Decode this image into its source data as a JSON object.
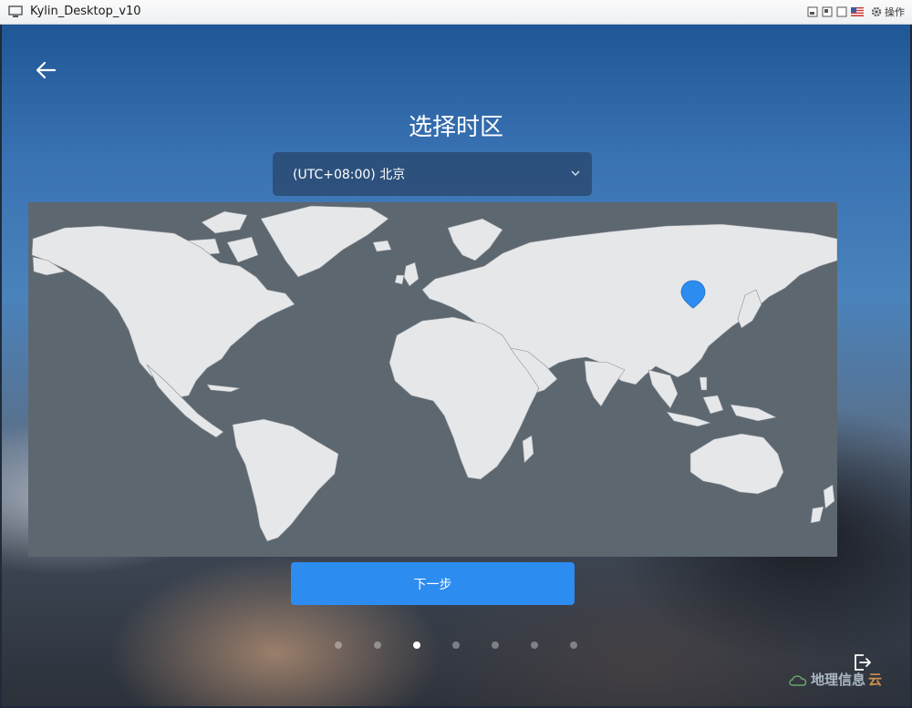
{
  "window": {
    "title": "Kylin_Desktop_v10",
    "operations_label": "操作"
  },
  "installer": {
    "title": "选择时区",
    "timezone_selected": "(UTC+08:00) 北京",
    "next_label": "下一步",
    "steps_total": 7,
    "steps_current": 3
  },
  "watermark": {
    "text": "地理信息",
    "suffix": "云"
  },
  "colors": {
    "accent": "#2d8cf0",
    "map_ocean": "#5d6770",
    "map_land": "#e6e7e9",
    "marker": "#2d8cf0"
  },
  "icons": {
    "back": "arrow-left-icon",
    "dropdown": "chevron-down-icon",
    "exit": "exit-icon",
    "marker": "location-pin-icon"
  }
}
